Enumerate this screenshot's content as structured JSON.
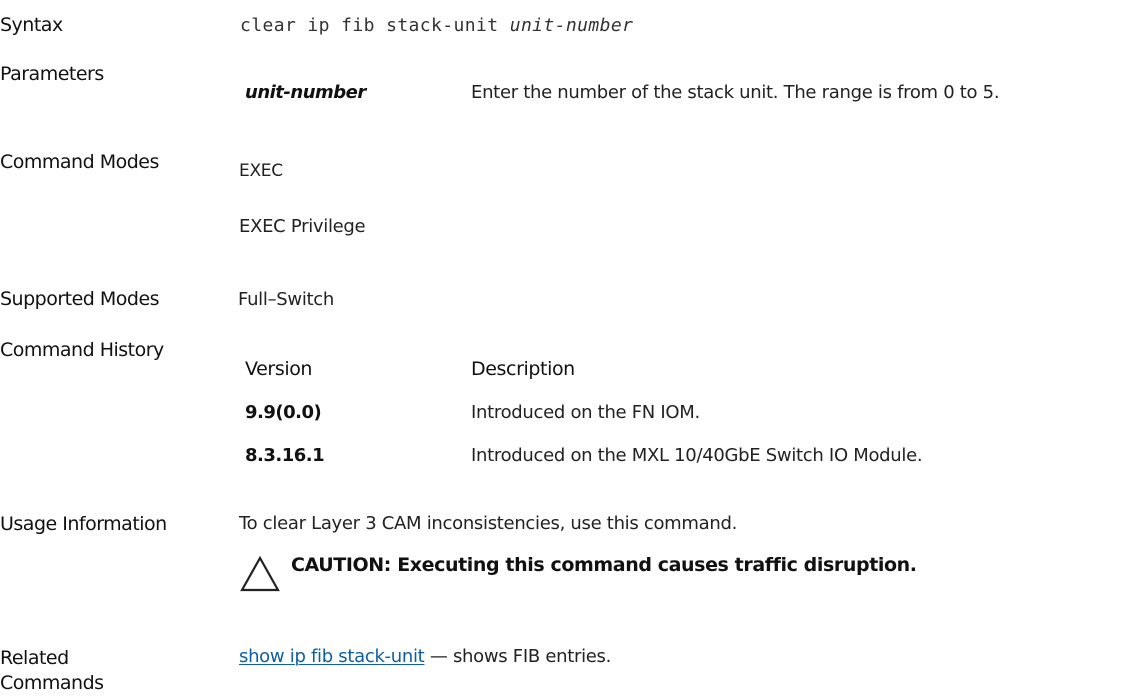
{
  "syntax": {
    "label": "Syntax",
    "command": "clear ip fib stack-unit",
    "argument": "unit-number"
  },
  "parameters": {
    "label": "Parameters",
    "items": [
      {
        "name": "unit-number",
        "description": "Enter the number of the stack unit. The range is from 0 to 5."
      }
    ]
  },
  "command_modes": {
    "label": "Command Modes",
    "modes": [
      "EXEC",
      "EXEC Privilege"
    ]
  },
  "supported_modes": {
    "label": "Supported Modes",
    "value": "Full–Switch"
  },
  "command_history": {
    "label": "Command History",
    "headers": [
      "Version",
      "Description"
    ],
    "rows": [
      {
        "version": "9.9(0.0)",
        "description": "Introduced on the FN IOM."
      },
      {
        "version": "8.3.16.1",
        "description": "Introduced on the MXL 10/40GbE Switch IO Module."
      }
    ]
  },
  "usage_information": {
    "label": "Usage Information",
    "text": "To clear Layer 3 CAM inconsistencies, use this command.",
    "caution": "CAUTION: Executing this command causes traffic disruption.",
    "caution_icon": "warning-triangle-icon"
  },
  "related_commands": {
    "label_line1": "Related",
    "label_line2": "Commands",
    "link_text": "show ip fib stack-unit",
    "link_suffix": " — shows FIB entries."
  }
}
